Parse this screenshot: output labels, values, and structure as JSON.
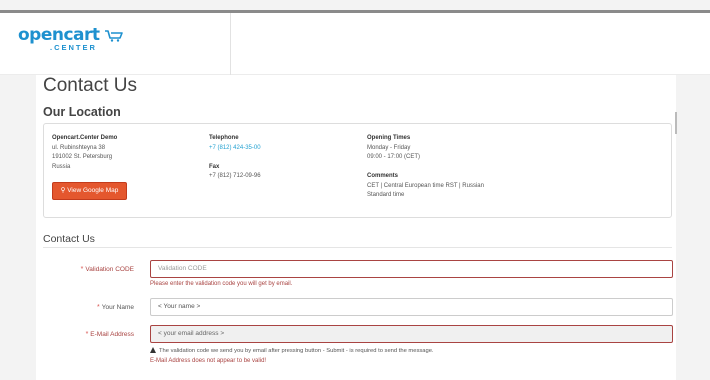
{
  "logo": {
    "main": "opencart",
    "sub": ".CENTER"
  },
  "page": {
    "title": "Contact Us",
    "location_title": "Our Location"
  },
  "location": {
    "store_name": "Opencart.Center Demo",
    "address_line1": "ul. Rubinshteyna 38",
    "address_line2": "191002 St. Petersburg",
    "address_line3": "Russia",
    "map_button": "View Google Map",
    "telephone_label": "Telephone",
    "telephone": "+7 (812) 424-35-00",
    "fax_label": "Fax",
    "fax": "+7 (812) 712-09-96",
    "opening_label": "Opening Times",
    "opening_days": "Monday - Friday",
    "opening_hours": "09:00 - 17:00 (CET)",
    "comments_label": "Comments",
    "comments_line1": "CET | Central European time RST | Russian",
    "comments_line2": "Standard time"
  },
  "form": {
    "legend": "Contact Us",
    "validation": {
      "label": "Validation CODE",
      "placeholder": "Validation CODE",
      "help": "Please enter the validation code you will get by email."
    },
    "name": {
      "label": "Your Name",
      "value": "< Your name >"
    },
    "email": {
      "label": "E-Mail Address",
      "value": "< your email address >",
      "note": "The validation code we send you by email after pressing button - Submit - is required to send the message.",
      "error": "E-Mail Address does not appear to be valid!"
    }
  },
  "colors": {
    "brand": "#1e91cf",
    "map_button": "#e4572e",
    "error": "#a94442",
    "link": "#23a1d1"
  }
}
